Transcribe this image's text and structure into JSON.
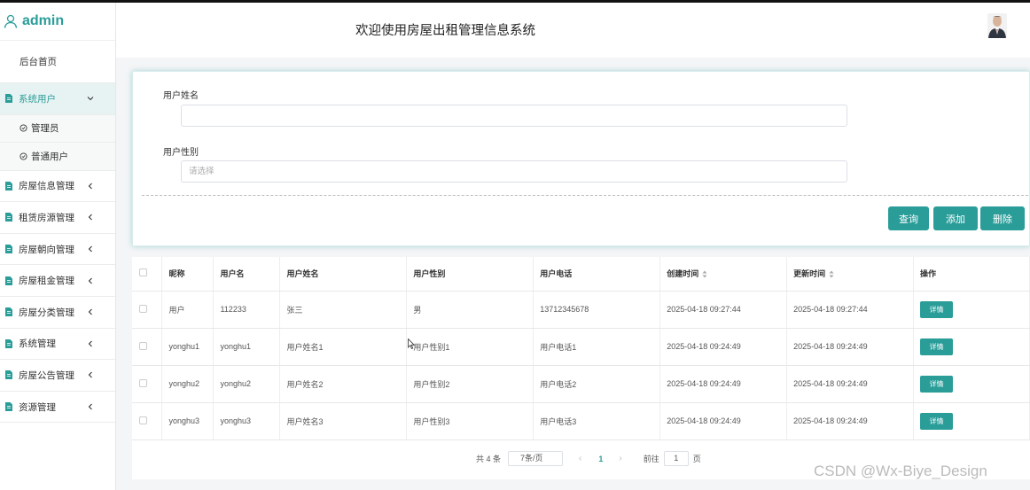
{
  "brand": {
    "title": "admin"
  },
  "header": {
    "title": "欢迎使用房屋出租管理信息系统"
  },
  "sidebar": {
    "home": "后台首页",
    "active_group": "系统用户",
    "sub_items": [
      {
        "label": "管理员"
      },
      {
        "label": "普通用户"
      }
    ],
    "items": [
      {
        "label": "房屋信息管理"
      },
      {
        "label": "租赁房源管理"
      },
      {
        "label": "房屋朝向管理"
      },
      {
        "label": "房屋租金管理"
      },
      {
        "label": "房屋分类管理"
      },
      {
        "label": "系统管理"
      },
      {
        "label": "房屋公告管理"
      },
      {
        "label": "资源管理"
      }
    ]
  },
  "search": {
    "name_label": "用户姓名",
    "name_value": "",
    "gender_label": "用户性别",
    "gender_placeholder": "请选择",
    "query_label": "查询",
    "add_label": "添加",
    "delete_label": "删除"
  },
  "table": {
    "headers": [
      "昵称",
      "用户名",
      "用户姓名",
      "用户性别",
      "用户电话",
      "创建时间",
      "更新时间",
      "操作"
    ],
    "rows": [
      {
        "nickname": "用户",
        "username": "112233",
        "realname": "张三",
        "gender": "男",
        "phone": "13712345678",
        "created": "2025-04-18 09:27:44",
        "updated": "2025-04-18 09:27:44",
        "action": "详情"
      },
      {
        "nickname": "yonghu1",
        "username": "yonghu1",
        "realname": "用户姓名1",
        "gender": "用户性别1",
        "phone": "用户电话1",
        "created": "2025-04-18 09:24:49",
        "updated": "2025-04-18 09:24:49",
        "action": "详情"
      },
      {
        "nickname": "yonghu2",
        "username": "yonghu2",
        "realname": "用户姓名2",
        "gender": "用户性别2",
        "phone": "用户电话2",
        "created": "2025-04-18 09:24:49",
        "updated": "2025-04-18 09:24:49",
        "action": "详情"
      },
      {
        "nickname": "yonghu3",
        "username": "yonghu3",
        "realname": "用户姓名3",
        "gender": "用户性别3",
        "phone": "用户电话3",
        "created": "2025-04-18 09:24:49",
        "updated": "2025-04-18 09:24:49",
        "action": "详情"
      }
    ]
  },
  "pagination": {
    "total_text": "共 4 条",
    "page_size": "7条/页",
    "prev_icon": "‹",
    "next_icon": "›",
    "current_page": "1",
    "goto_label": "前往",
    "goto_value": "1",
    "page_suffix": "页"
  },
  "watermark": "CSDN @Wx-Biye_Design",
  "colors": {
    "accent": "#2a9d99"
  }
}
